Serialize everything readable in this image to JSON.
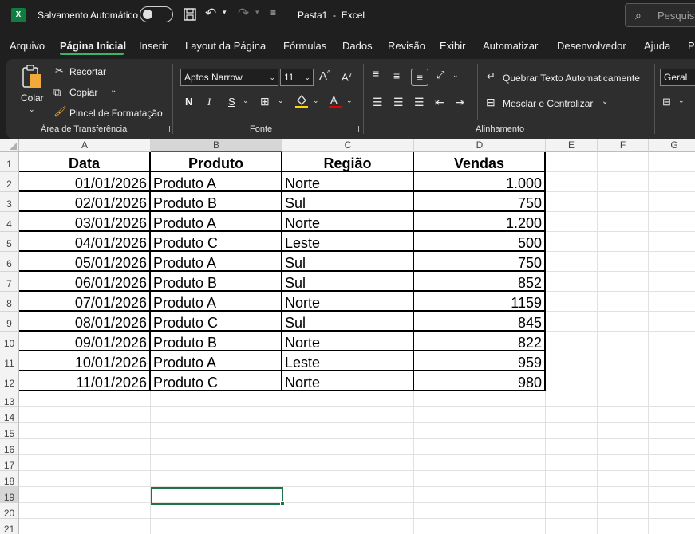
{
  "titlebar": {
    "app_icon": "X",
    "autosave_label": "Salvamento Automático",
    "doc_title": "Pasta1  -  Excel",
    "search_placeholder": "Pesquisa",
    "icons": [
      "save-icon",
      "undo-icon",
      "redo-icon",
      "customize-icon"
    ]
  },
  "tabs": [
    "Arquivo",
    "Página Inicial",
    "Inserir",
    "Layout da Página",
    "Fórmulas",
    "Dados",
    "Revisão",
    "Exibir",
    "Automatizar",
    "Desenvolvedor",
    "Ajuda",
    "Pe"
  ],
  "active_tab": "Página Inicial",
  "ribbon": {
    "clipboard": {
      "paste": "Colar",
      "cut": "Recortar",
      "copy": "Copiar",
      "format_painter": "Pincel de Formatação",
      "group": "Área de Transferência"
    },
    "font": {
      "font_name": "Aptos Narrow",
      "font_size": "11",
      "bold": "N",
      "italic": "I",
      "underline": "S",
      "fill_color": "#ffd700",
      "font_color": "#e00000",
      "group": "Fonte"
    },
    "alignment": {
      "wrap_text": "Quebrar Texto Automaticamente",
      "merge_center": "Mesclar e Centralizar",
      "group": "Alinhamento"
    },
    "number": {
      "format": "Geral"
    }
  },
  "grid": {
    "columns": [
      "A",
      "B",
      "C",
      "D",
      "E",
      "F",
      "G"
    ],
    "rows": [
      "1",
      "2",
      "3",
      "4",
      "5",
      "6",
      "7",
      "8",
      "9",
      "10",
      "11",
      "12",
      "13",
      "14",
      "15",
      "16",
      "17",
      "18",
      "19",
      "20",
      "21"
    ],
    "headers": [
      "Data",
      "Produto",
      "Região",
      "Vendas"
    ],
    "data": [
      [
        "01/01/2026",
        "Produto A",
        "Norte",
        "1.000"
      ],
      [
        "02/01/2026",
        "Produto B",
        "Sul",
        "750"
      ],
      [
        "03/01/2026",
        "Produto A",
        "Norte",
        "1.200"
      ],
      [
        "04/01/2026",
        "Produto C",
        "Leste",
        "500"
      ],
      [
        "05/01/2026",
        "Produto A",
        "Sul",
        "750"
      ],
      [
        "06/01/2026",
        "Produto B",
        "Sul",
        "852"
      ],
      [
        "07/01/2026",
        "Produto A",
        "Norte",
        "1159"
      ],
      [
        "08/01/2026",
        "Produto C",
        "Sul",
        "845"
      ],
      [
        "09/01/2026",
        "Produto B",
        "Norte",
        "822"
      ],
      [
        "10/01/2026",
        "Produto A",
        "Leste",
        "959"
      ],
      [
        "11/01/2026",
        "Produto C",
        "Norte",
        "980"
      ]
    ],
    "selected_cell": "B19"
  }
}
